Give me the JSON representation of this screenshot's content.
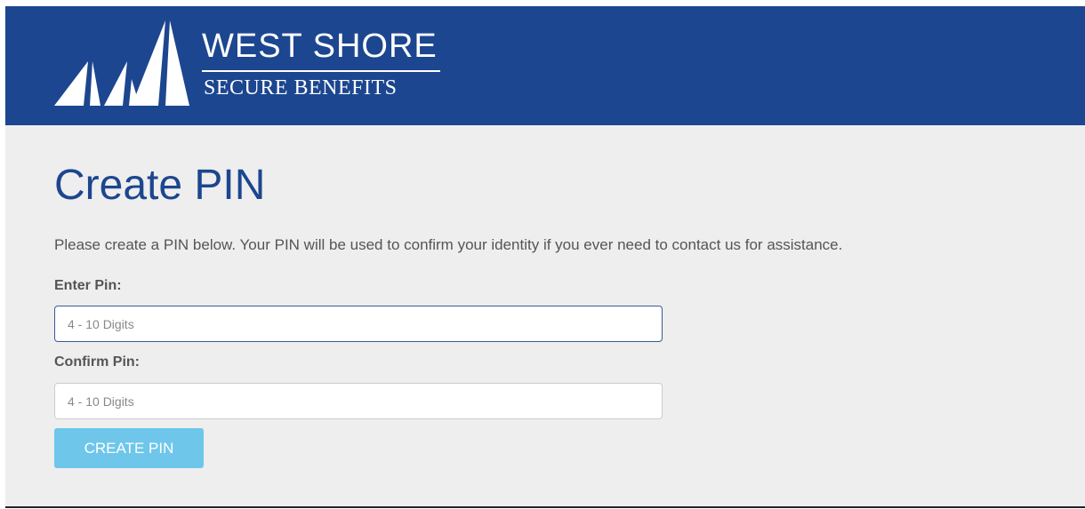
{
  "header": {
    "brand_line1": "WEST SHORE",
    "brand_line2": "SECURE BENEFITS",
    "logo_icon": "sailboats-icon",
    "background_color": "#1c468f"
  },
  "main": {
    "title": "Create PIN",
    "intro": "Please create a PIN below. Your PIN will be used to confirm your identity if you ever need to contact us for assistance.",
    "enter_pin_label": "Enter Pin:",
    "enter_pin_placeholder": "4 - 10 Digits",
    "enter_pin_value": "",
    "confirm_pin_label": "Confirm Pin:",
    "confirm_pin_placeholder": "4 - 10 Digits",
    "confirm_pin_value": "",
    "submit_label": "CREATE PIN",
    "button_color": "#6ec6ea",
    "title_color": "#1c468f"
  }
}
